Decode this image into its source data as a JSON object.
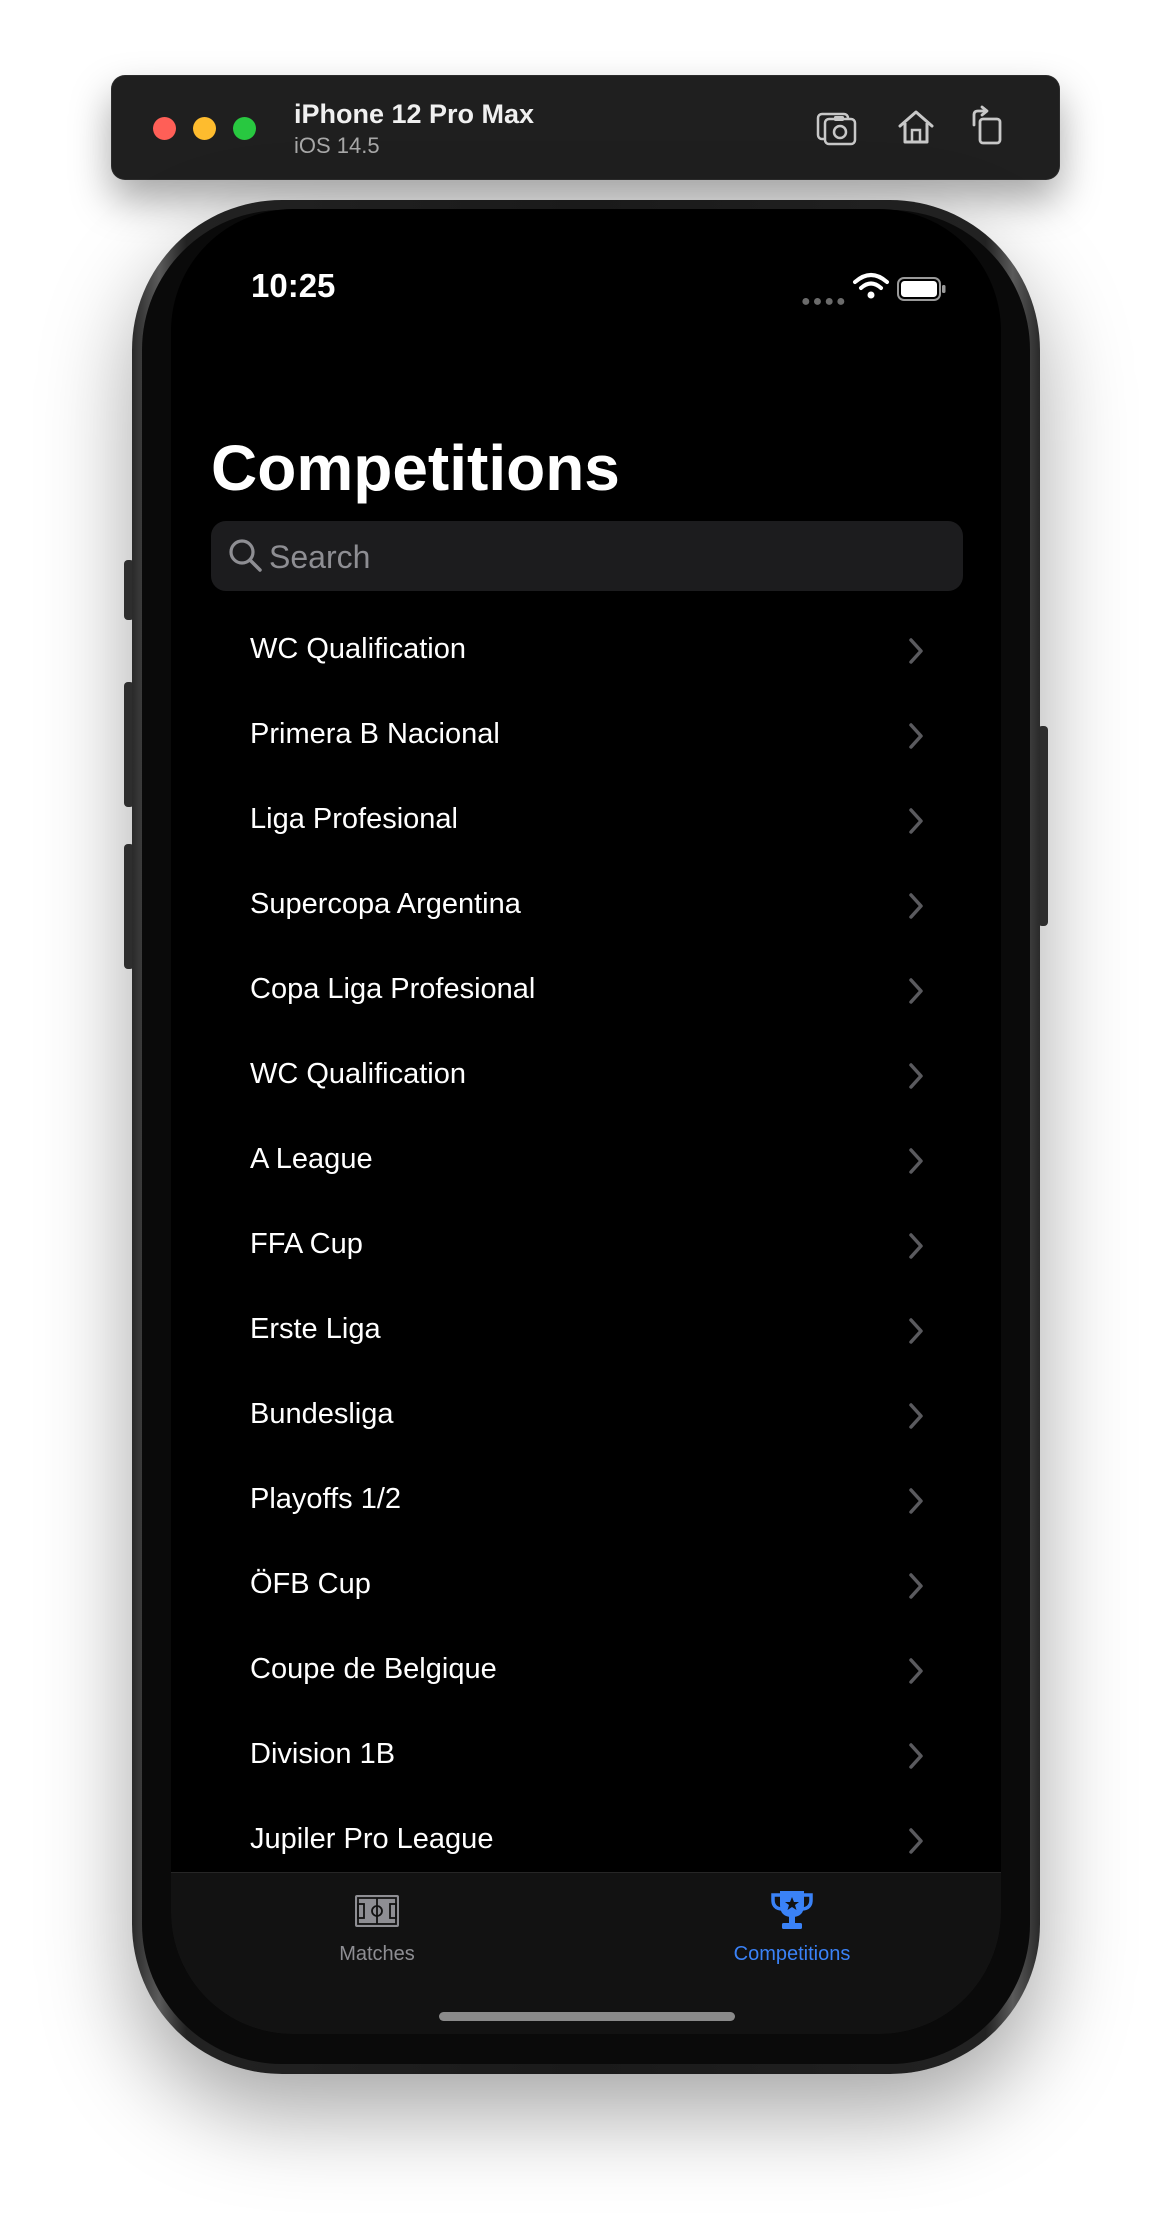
{
  "simulator": {
    "device_name": "iPhone 12 Pro Max",
    "os_version": "iOS 14.5",
    "icons": [
      "screenshot-icon",
      "home-icon",
      "rotate-icon"
    ]
  },
  "status_bar": {
    "time": "10:25",
    "icons": [
      "signal-dots-icon",
      "wifi-icon",
      "battery-icon"
    ]
  },
  "page": {
    "title": "Competitions",
    "search_placeholder": "Search"
  },
  "competitions": [
    "WC Qualification",
    "Primera B Nacional",
    "Liga Profesional",
    "Supercopa Argentina",
    "Copa Liga Profesional",
    "WC Qualification",
    "A League",
    "FFA Cup",
    "Erste Liga",
    "Bundesliga",
    "Playoffs 1/2",
    "ÖFB Cup",
    "Coupe de Belgique",
    "Division 1B",
    "Jupiler Pro League"
  ],
  "tab_bar": {
    "tabs": [
      {
        "label": "Matches",
        "icon": "field-icon",
        "selected": false
      },
      {
        "label": "Competitions",
        "icon": "trophy-icon",
        "selected": true
      }
    ],
    "active_color": "#3a82f7",
    "inactive_color": "#8e8e93"
  }
}
